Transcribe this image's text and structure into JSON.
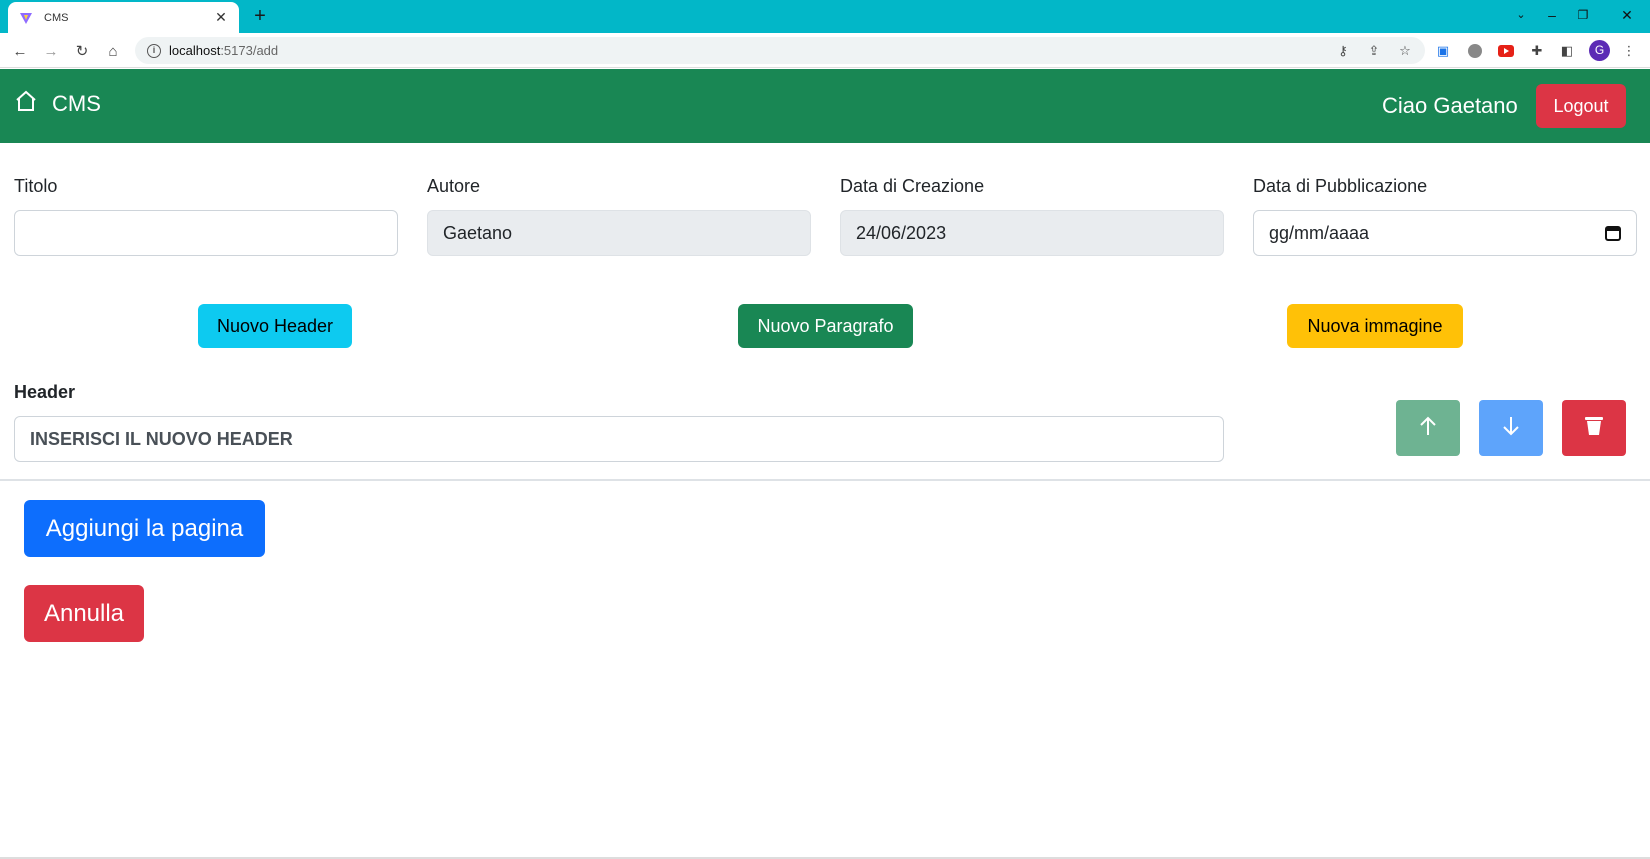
{
  "browser": {
    "tab_title": "CMS",
    "new_tab": "+",
    "url_host": "localhost",
    "url_path": ":5173/add"
  },
  "navbar": {
    "brand": "CMS",
    "greeting": "Ciao Gaetano",
    "logout": "Logout"
  },
  "form": {
    "titolo": {
      "label": "Titolo",
      "value": ""
    },
    "autore": {
      "label": "Autore",
      "value": "Gaetano"
    },
    "data_creazione": {
      "label": "Data di Creazione",
      "value": "24/06/2023"
    },
    "data_pubblicazione": {
      "label": "Data di Pubblicazione",
      "value": "gg/mm/aaaa"
    }
  },
  "actions": {
    "nuovo_header": "Nuovo Header",
    "nuovo_paragrafo": "Nuovo Paragrafo",
    "nuova_immagine": "Nuova immagine"
  },
  "block": {
    "label": "Header",
    "value": "INSERISCI IL NUOVO HEADER"
  },
  "footer": {
    "add": "Aggiungi la pagina",
    "cancel": "Annulla"
  },
  "colors": {
    "tabbar": "#02b7c8",
    "navbar": "#198754",
    "danger": "#dc3545",
    "info": "#0dcaf0",
    "warning": "#ffc107",
    "primary": "#0d6efd"
  }
}
